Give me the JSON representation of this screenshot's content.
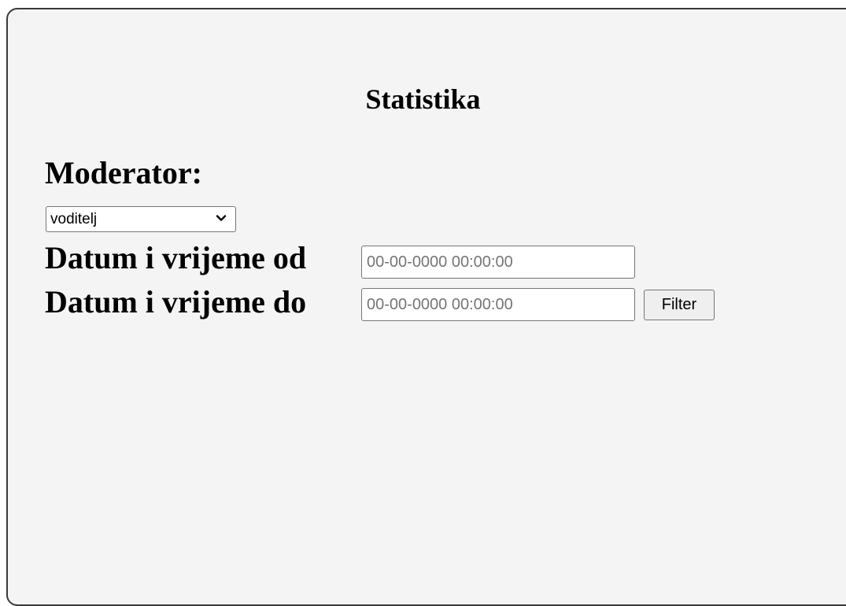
{
  "page": {
    "title": "Statistika"
  },
  "moderator": {
    "label": "Moderator:",
    "selected": "voditelj",
    "icon": "chevron-down-icon"
  },
  "date_from": {
    "label": "Datum i vrijeme od",
    "value": "",
    "placeholder": "00-00-0000 00:00:00"
  },
  "date_to": {
    "label": "Datum i vrijeme do",
    "value": "",
    "placeholder": "00-00-0000 00:00:00"
  },
  "filter": {
    "label": "Filter"
  },
  "colors": {
    "panel_background": "#f4f4f4",
    "panel_border": "#3a3a3a",
    "text": "#000000"
  }
}
